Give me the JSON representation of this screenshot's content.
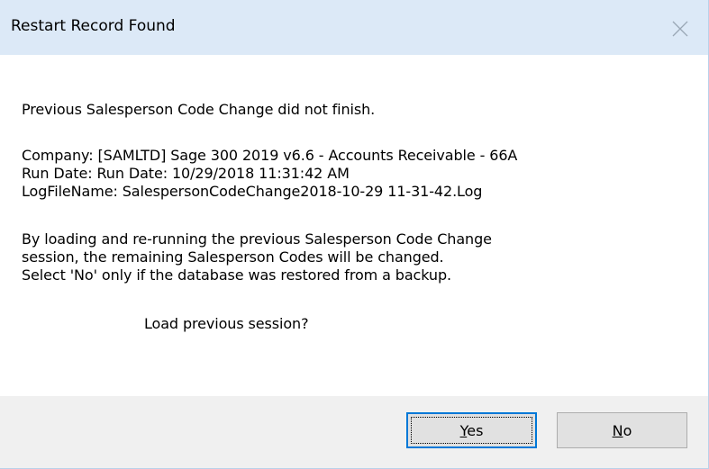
{
  "window": {
    "title": "Restart Record Found",
    "close_icon": "close-icon"
  },
  "message": {
    "line1": "Previous Salesperson Code Change did not finish.",
    "company": "Company:  [SAMLTD] Sage 300  2019  v6.6 - Accounts Receivable - 66A",
    "run_date": "Run Date: Run Date: 10/29/2018  11:31:42 AM",
    "log_file": "LogFileName: SalespersonCodeChange2018-10-29 11-31-42.Log",
    "body1": "By loading and re-running the previous Salesperson Code Change",
    "body2": "session, the remaining Salesperson Codes will be changed.",
    "body3": "Select 'No' only if the database was restored from a backup.",
    "question": "Load previous session?"
  },
  "buttons": {
    "yes_mnemonic": "Y",
    "yes_rest": "es",
    "no_mnemonic": "N",
    "no_rest": "o"
  }
}
